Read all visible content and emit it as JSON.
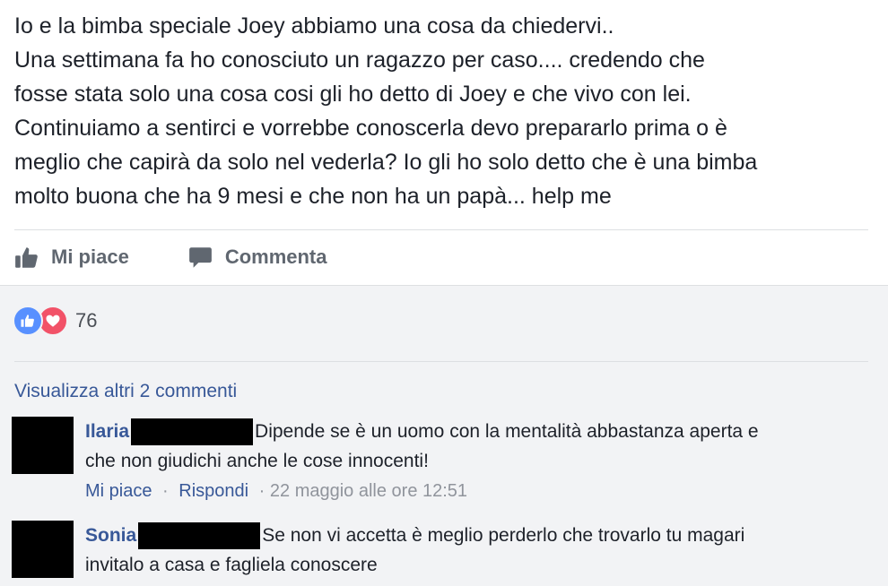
{
  "post": {
    "lines": [
      "Io e la bimba speciale Joey abbiamo una cosa da chiedervi..",
      "Una settimana fa ho conosciuto un ragazzo per caso.... credendo che",
      "fosse stata solo una cosa cosi gli ho detto di Joey e che vivo con lei.",
      "Continuiamo a sentirci e vorrebbe conoscerla devo prepararlo prima o è",
      "meglio che capirà da solo nel vederla? Io gli ho solo detto che è una bimba",
      "molto buona che ha 9 mesi e che non ha un papà... help me"
    ]
  },
  "actions": {
    "like_label": "Mi piace",
    "comment_label": "Commenta",
    "like_icon": "thumbs-up-icon",
    "comment_icon": "speech-bubble-icon"
  },
  "reactions": {
    "count": "76",
    "types": [
      "like",
      "love"
    ],
    "like_color": "#5890ff",
    "love_color": "#f25268"
  },
  "comments_section": {
    "view_more": "Visualizza altri 2 commenti",
    "comments": [
      {
        "author": "Ilaria",
        "text_line1": "Dipende se è un uomo con la mentalità abbastanza aperta e",
        "text_line2": "che non giudichi anche le cose innocenti!",
        "like_label": "Mi piace",
        "separator": "·",
        "reply_label": "Rispondi",
        "timestamp": "· 22 maggio alle ore 12:51"
      },
      {
        "author": "Sonia",
        "text_line1": "Se non vi accetta è meglio perderlo che trovarlo tu magari",
        "text_line2": "invitalo a casa e fagliela conoscere"
      }
    ]
  },
  "colors": {
    "link": "#385898",
    "text": "#1d2129",
    "muted": "#90949c",
    "background_comments": "#f2f3f5"
  }
}
